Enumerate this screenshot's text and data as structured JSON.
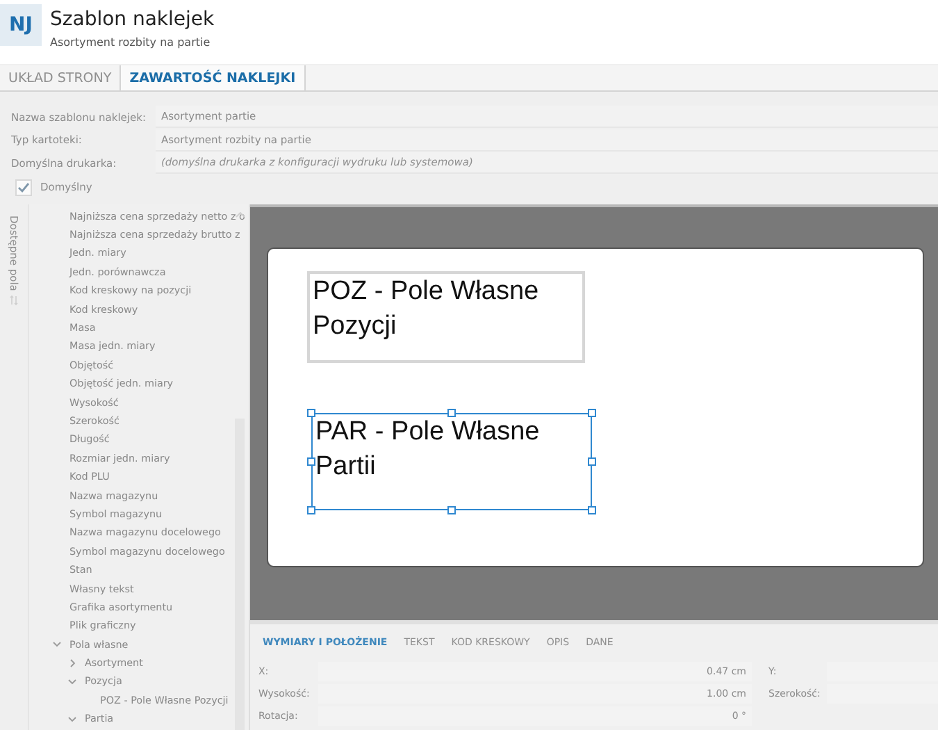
{
  "header": {
    "badge": "NJ",
    "title": "Szablon naklejek",
    "subtitle": "Asortyment rozbity na partie"
  },
  "tabs": [
    {
      "label": "UKŁAD STRONY",
      "selected": false
    },
    {
      "label": "ZAWARTOŚĆ NAKLEJKI",
      "selected": true
    }
  ],
  "form": [
    {
      "label": "Nazwa szablonu naklejek:",
      "value": "Asortyment partie"
    },
    {
      "label": "Typ kartoteki:",
      "value": "Asortyment rozbity na partie"
    },
    {
      "label": "Domyślna drukarka:",
      "placeholder": "(domyślna drukarka z konfiguracji wydruku lub systemowa)"
    }
  ],
  "default_checkbox": {
    "label": "Domyślny",
    "checked": true
  },
  "fields_panel": {
    "title": "Dostępne pola",
    "items": [
      {
        "label": "Najniższa cena sprzedaży netto z o"
      },
      {
        "label": "Najniższa cena sprzedaży brutto z"
      },
      {
        "label": "Jedn. miary"
      },
      {
        "label": "Jedn. porównawcza"
      },
      {
        "label": "Kod kreskowy na pozycji"
      },
      {
        "label": "Kod kreskowy"
      },
      {
        "label": "Masa"
      },
      {
        "label": "Masa jedn. miary"
      },
      {
        "label": "Objętość"
      },
      {
        "label": "Objętość jedn. miary"
      },
      {
        "label": "Wysokość"
      },
      {
        "label": "Szerokość"
      },
      {
        "label": "Długość"
      },
      {
        "label": "Rozmiar jedn. miary"
      },
      {
        "label": "Kod PLU"
      },
      {
        "label": "Nazwa magazynu"
      },
      {
        "label": "Symbol magazynu"
      },
      {
        "label": "Nazwa magazynu docelowego"
      },
      {
        "label": "Symbol magazynu docelowego"
      },
      {
        "label": "Stan"
      },
      {
        "label": "Własny tekst"
      },
      {
        "label": "Grafika asortymentu"
      },
      {
        "label": "Plik graficzny"
      },
      {
        "label": "Pola własne",
        "expanded": true,
        "children": [
          {
            "label": "Asortyment",
            "expanded": false
          },
          {
            "label": "Pozycja",
            "expanded": true,
            "children": [
              {
                "label": "POZ - Pole Własne Pozycji"
              }
            ]
          },
          {
            "label": "Partia",
            "expanded": true
          }
        ]
      }
    ]
  },
  "label_fields": [
    {
      "text": "POZ - Pole Własne Pozycji",
      "selected": false
    },
    {
      "text": "PAR - Pole Własne Partii",
      "selected": true
    }
  ],
  "property_tabs": [
    {
      "label": "WYMIARY I POŁOŻENIE",
      "selected": true
    },
    {
      "label": "TEKST",
      "selected": false
    },
    {
      "label": "KOD KRESKOWY",
      "selected": false
    },
    {
      "label": "OPIS",
      "selected": false
    },
    {
      "label": "DANE",
      "selected": false
    }
  ],
  "properties": [
    {
      "label": "X:",
      "value": "0.47 cm",
      "label_2": "Y:"
    },
    {
      "label": "Wysokość:",
      "value": "1.00 cm",
      "label_2": "Szerokość:"
    },
    {
      "label": "Rotacja:",
      "value": "0 °"
    }
  ]
}
